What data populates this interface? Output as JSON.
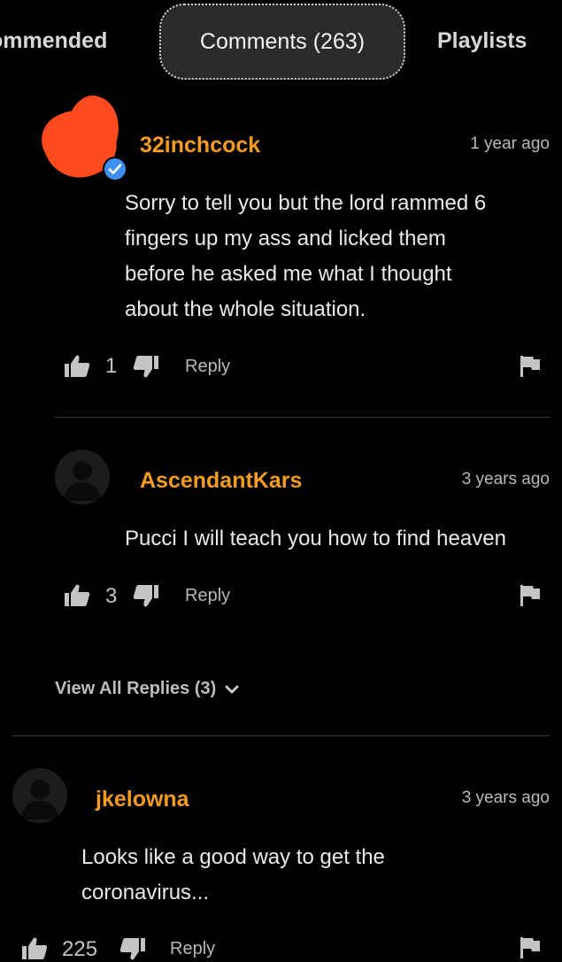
{
  "tabs": [
    {
      "label": "ommended"
    },
    {
      "label": "Comments (263)"
    },
    {
      "label": "Playlists"
    }
  ],
  "comments": [
    {
      "username": "32inchcock",
      "timestamp": "1 year ago",
      "text_lines": [
        "Sorry to tell you but the lord rammed 6",
        "fingers up my ass and licked them",
        "before he asked me what I thought",
        "about the whole situation."
      ],
      "likes": "1",
      "reply_label": "Reply"
    },
    {
      "username": "AscendantKars",
      "timestamp": "3 years ago",
      "text_lines": [
        "Pucci I will teach you how to find heaven"
      ],
      "likes": "3",
      "reply_label": "Reply"
    },
    {
      "username": "jkelowna",
      "timestamp": "3 years ago",
      "text_lines": [
        "Looks like a good way to get the",
        "coronavirus..."
      ],
      "likes": "225",
      "reply_label": "Reply"
    }
  ],
  "view_replies_label": "View All Replies (3)",
  "colors": {
    "username": "#f39c1f",
    "background": "#000000",
    "verified_badge": "#3d8ff0"
  },
  "icons": [
    "thumbs-up-icon",
    "thumbs-down-icon",
    "flag-icon",
    "chevron-down-icon",
    "verified-check-icon",
    "avatar-silhouette-icon"
  ]
}
